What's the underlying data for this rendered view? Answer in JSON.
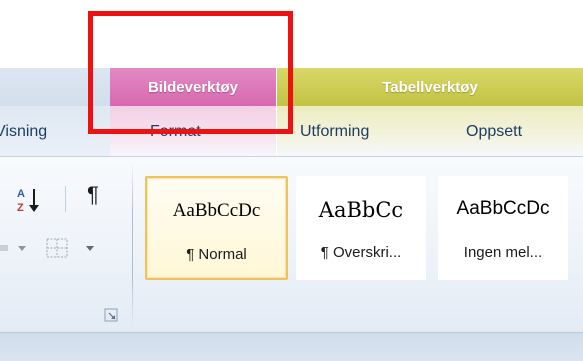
{
  "contextual_tabs": {
    "bilde": {
      "header": "Bildeverktøy",
      "tab": "Format",
      "color": "#d868b0"
    },
    "tabell": {
      "header": "Tabellverktøy",
      "tabs": [
        "Utforming",
        "Oppsett"
      ],
      "color": "#c2c244"
    }
  },
  "tabs": {
    "visning": "Visning"
  },
  "paragraph": {
    "sort_icon": "sort-az-icon",
    "sort_glyph": "A↓",
    "pilcrow_glyph": "¶",
    "shading_icon": "shading-icon",
    "borders_icon": "borders-icon",
    "dialog_launcher_icon": "dialog-launcher-icon"
  },
  "styles": {
    "items": [
      {
        "sample": "AaBbCcDc",
        "caption": "¶ Normal",
        "selected": true
      },
      {
        "sample": "AaBbCc",
        "caption": "¶ Overskri...",
        "selected": false
      },
      {
        "sample": "AaBbCcDc",
        "caption": "Ingen mel...",
        "selected": false
      }
    ]
  },
  "highlight": {
    "color": "#ee1111"
  }
}
